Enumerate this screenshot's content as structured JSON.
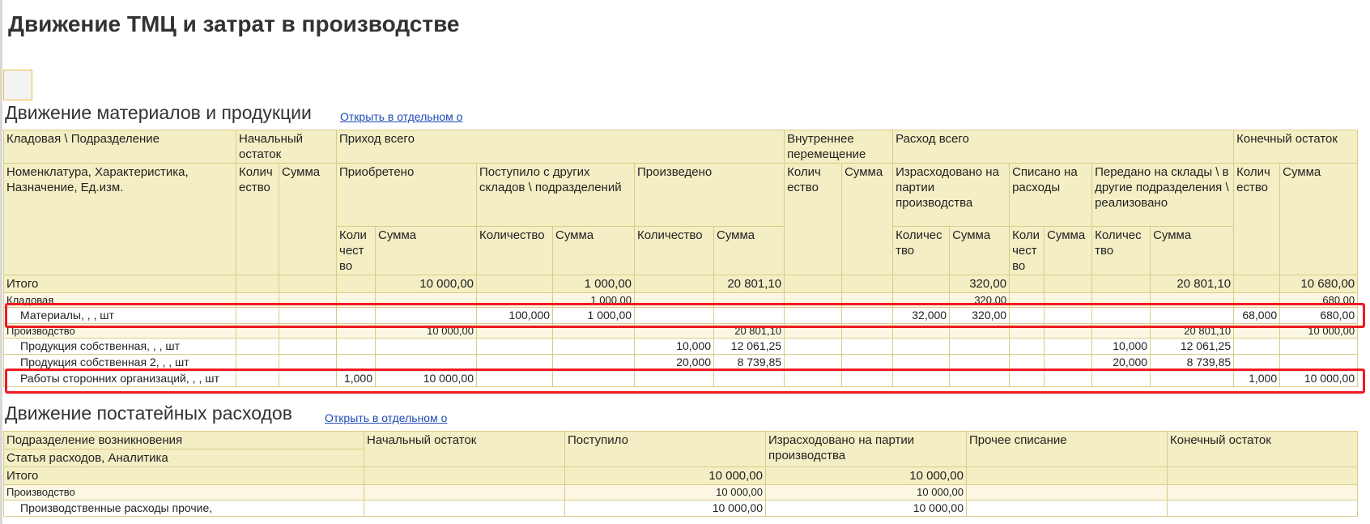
{
  "page_title": "Движение ТМЦ и затрат в производстве",
  "materials": {
    "title": "Движение материалов и продукции",
    "link": "Открыть в отдельном о",
    "h": {
      "sklad": "Кладовая \\ Подразделение",
      "nom": "Номенклатура, Характеристика, Назначение, Ед.изм.",
      "nach": "Начальный остаток",
      "prihod": "Приход всего",
      "vnutr": "Внутреннее перемещение",
      "rashod": "Расход всего",
      "kon": "Конечный остаток",
      "priobr": "Приобретено",
      "postup": "Поступило с других складов \\ подразделений",
      "proizv": "Произведено",
      "izrash": "Израсходовано на партии производства",
      "spisano": "Списано на расходы",
      "peredano": "Передано на склады \\ в другие подразделения \\ реализовано",
      "kolichestvo_a": "Колич ество",
      "summa": "Сумма",
      "kolichestvo_b": "Коли чест во",
      "kolichestvo_c": "Количество",
      "kolichestvo_d": "Количес тво",
      "kolichestvo_e": "Колич ество"
    },
    "rows": [
      {
        "name": "Итого",
        "priobr_s": "10 000,00",
        "postup_s": "1 000,00",
        "proizv_s": "20 801,10",
        "izr_s": "320,00",
        "per_s": "20 801,10",
        "kon_s": "10 680,00"
      },
      {
        "name": "Кладовая",
        "postup_s": "1 000,00",
        "izr_s": "320,00",
        "kon_s": "680,00"
      },
      {
        "name": "Материалы, , , шт",
        "postup_k": "100,000",
        "postup_s": "1 000,00",
        "izr_k": "32,000",
        "izr_s": "320,00",
        "kon_k": "68,000",
        "kon_s": "680,00"
      },
      {
        "name": "Производство",
        "priobr_s": "10 000,00",
        "proizv_s": "20 801,10",
        "per_s": "20 801,10",
        "kon_s": "10 000,00"
      },
      {
        "name": "Продукция собственная, , , шт",
        "proizv_k": "10,000",
        "proizv_s": "12 061,25",
        "per_k": "10,000",
        "per_s": "12 061,25"
      },
      {
        "name": "Продукция собственная 2, , , шт",
        "proizv_k": "20,000",
        "proizv_s": "8 739,85",
        "per_k": "20,000",
        "per_s": "8 739,85"
      },
      {
        "name": "Работы сторонних организаций, , , шт",
        "priobr_k": "1,000",
        "priobr_s": "10 000,00",
        "kon_k": "1,000",
        "kon_s": "10 000,00"
      }
    ]
  },
  "costs": {
    "title": "Движение постатейных расходов",
    "link": "Открыть в отдельном о",
    "h": {
      "podr": "Подразделение возникновения",
      "statya": "Статья расходов, Аналитика",
      "nach": "Начальный остаток",
      "postup": "Поступило",
      "izrash": "Израсходовано на партии производства",
      "prochee": "Прочее списание",
      "kon": "Конечный остаток"
    },
    "rows": [
      {
        "name": "Итого",
        "postup": "10 000,00",
        "izrash": "10 000,00"
      },
      {
        "name": "Производство",
        "postup": "10 000,00",
        "izrash": "10 000,00"
      },
      {
        "name": "Производственные расходы прочие,",
        "postup": "10 000,00",
        "izrash": "10 000,00"
      }
    ]
  }
}
